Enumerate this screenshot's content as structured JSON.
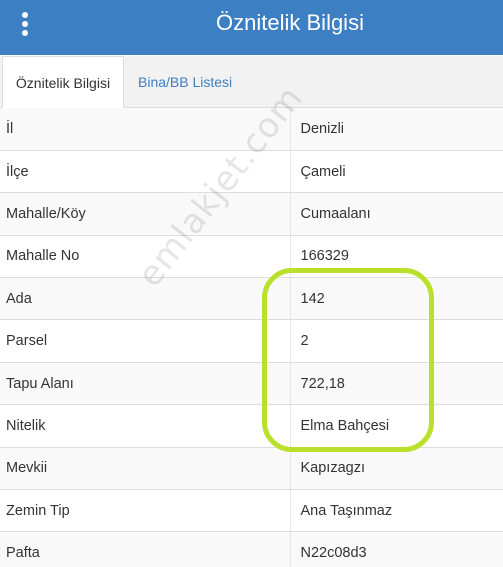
{
  "header": {
    "title": "Öznitelik Bilgisi",
    "menu_icon": "kebab-menu-icon"
  },
  "tabs": [
    {
      "label": "Öznitelik Bilgisi",
      "active": true
    },
    {
      "label": "Bina/BB Listesi",
      "active": false
    }
  ],
  "attributes": [
    {
      "key": "İl",
      "value": "Denizli"
    },
    {
      "key": "İlçe",
      "value": "Çameli"
    },
    {
      "key": "Mahalle/Köy",
      "value": "Cumaalanı"
    },
    {
      "key": "Mahalle No",
      "value": "166329"
    },
    {
      "key": "Ada",
      "value": "142"
    },
    {
      "key": "Parsel",
      "value": "2"
    },
    {
      "key": "Tapu Alanı",
      "value": "722,18"
    },
    {
      "key": "Nitelik",
      "value": "Elma Bahçesi"
    },
    {
      "key": "Mevkii",
      "value": "Kapızagzı"
    },
    {
      "key": "Zemin Tip",
      "value": "Ana Taşınmaz"
    },
    {
      "key": "Pafta",
      "value": "N22c08d3"
    }
  ],
  "watermark": "emlakjet.com",
  "colors": {
    "header_bg": "#3d7fc3",
    "tab_link": "#3d7fc3",
    "highlight": "#b9e02a"
  }
}
